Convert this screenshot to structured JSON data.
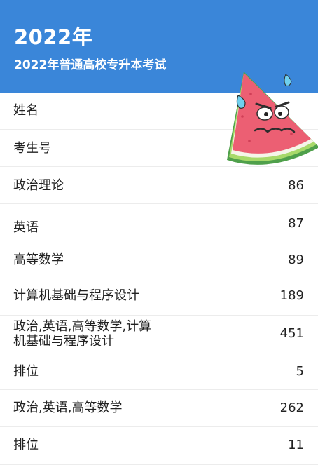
{
  "header": {
    "year": "2022年",
    "subtitle": "2022年普通高校专升本考试"
  },
  "rows": [
    {
      "label": "姓名",
      "value": ""
    },
    {
      "label": "考生号",
      "value": ""
    },
    {
      "label": "政治理论",
      "value": "86"
    },
    {
      "label": "英语",
      "value": "87"
    },
    {
      "label": "高等数学",
      "value": "89"
    },
    {
      "label": "计算机基础与程序设计",
      "value": "189"
    },
    {
      "label": "政治,英语,高等数学,计算机基础与程序设计",
      "label_line1": "政治,英语,高等数学,计算",
      "label_line2": "机基础与程序设计",
      "value": "451"
    },
    {
      "label": "排位",
      "value": "5"
    },
    {
      "label": "政治,英语,高等数学",
      "value": "262"
    },
    {
      "label": "排位",
      "value": "11"
    }
  ],
  "sticker": {
    "icon": "watermelon-sticker-icon"
  }
}
